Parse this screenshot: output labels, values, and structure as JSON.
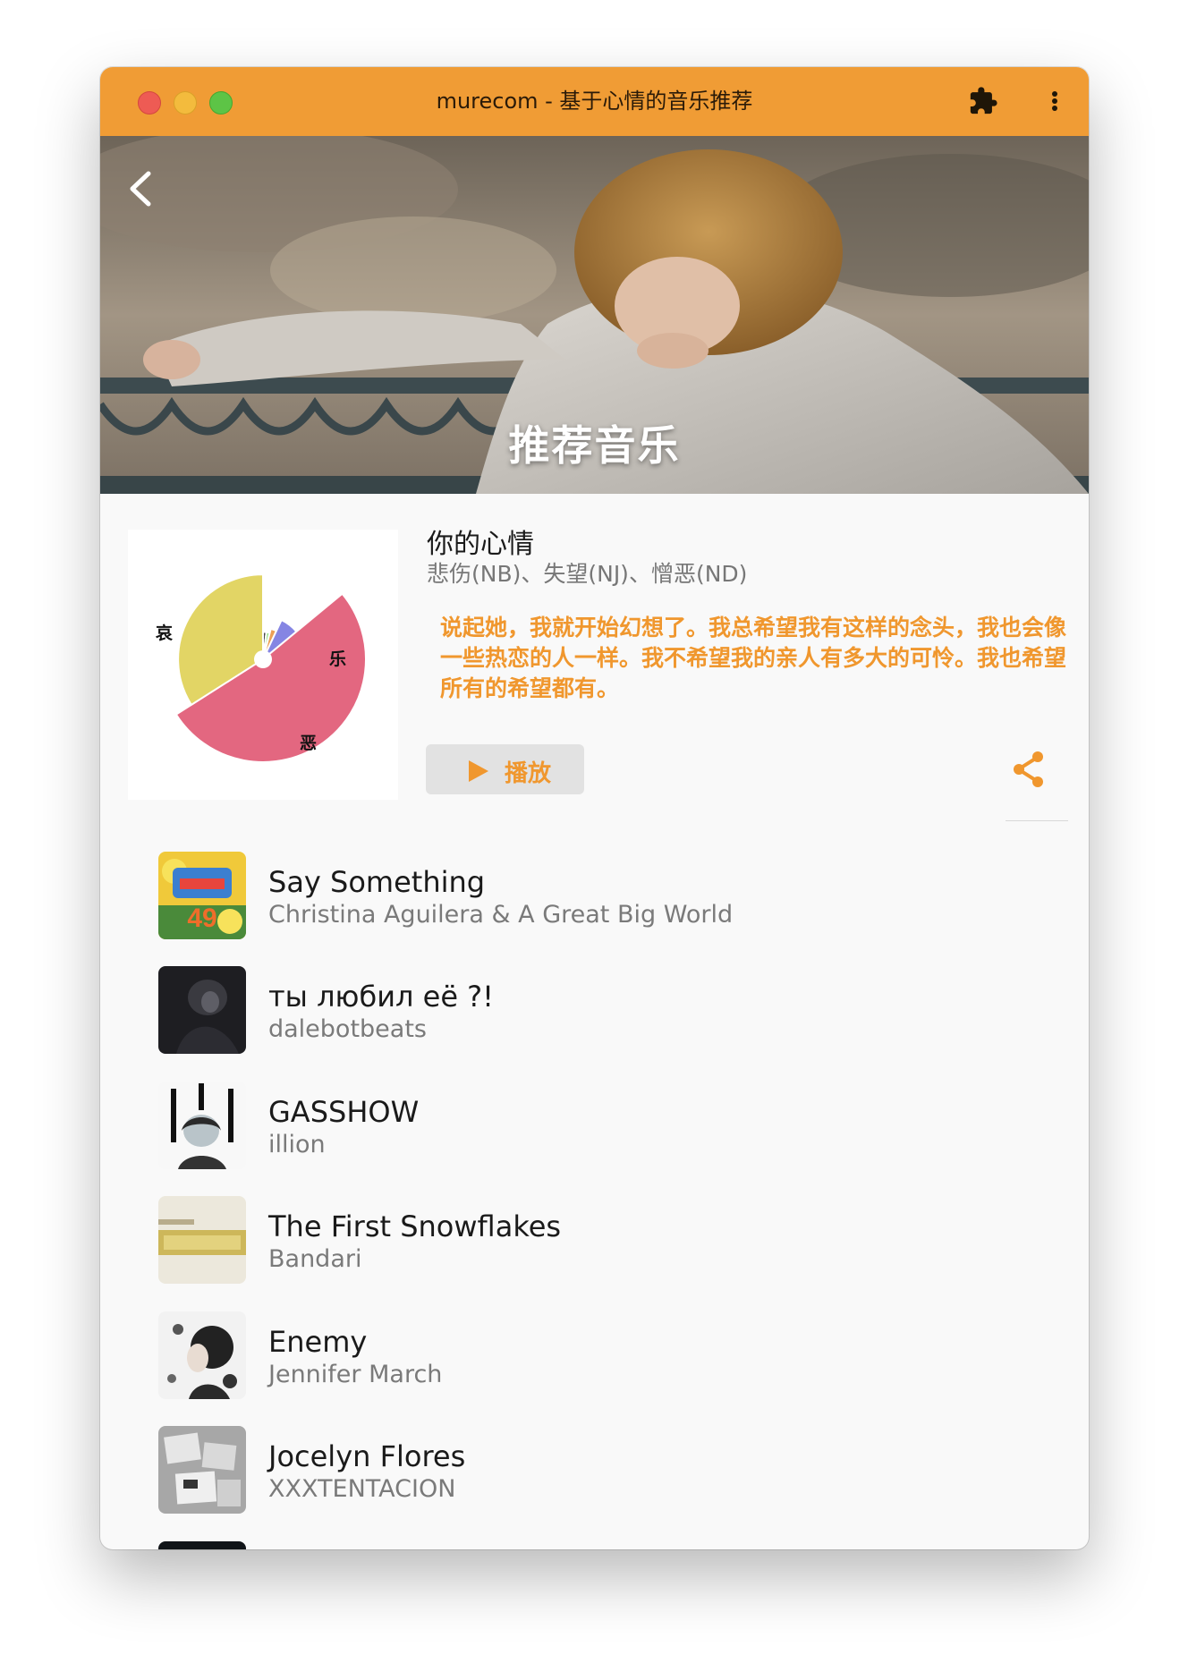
{
  "window": {
    "title": "murecom - 基于心情的音乐推荐"
  },
  "header": {
    "title": "推荐音乐",
    "back_icon": "chevron-left-icon"
  },
  "mood": {
    "heading": "你的心情",
    "emotions": "悲伤(NB)、失望(NJ)、憎恶(ND)",
    "description": "说起她，我就开始幻想了。我总希望我有这样的念头，我也会像一些热恋的人一样。我不希望我的亲人有多大的可怜。我也希望所有的希望都有。",
    "chart_data": {
      "type": "pie",
      "labels": [
        "哀",
        "乐",
        "恶"
      ],
      "colors": [
        "#e2d565",
        "#4a4a4a",
        "#96e089",
        "#eca056",
        "#8585e3",
        "#e36780"
      ],
      "values": [
        34,
        2,
        2,
        3,
        7,
        52
      ]
    }
  },
  "actions": {
    "play_label": "播放",
    "accent": "#f09c35"
  },
  "tracks": [
    {
      "title": "Say Something",
      "artist": "Christina Aguilera & A Great Big World"
    },
    {
      "title": "ты любил её ?!",
      "artist": "dalebotbeats"
    },
    {
      "title": "GASSHOW",
      "artist": "illion"
    },
    {
      "title": "The First Snowflakes",
      "artist": "Bandari"
    },
    {
      "title": "Enemy",
      "artist": "Jennifer March"
    },
    {
      "title": "Jocelyn Flores",
      "artist": "XXXTENTACION"
    }
  ]
}
